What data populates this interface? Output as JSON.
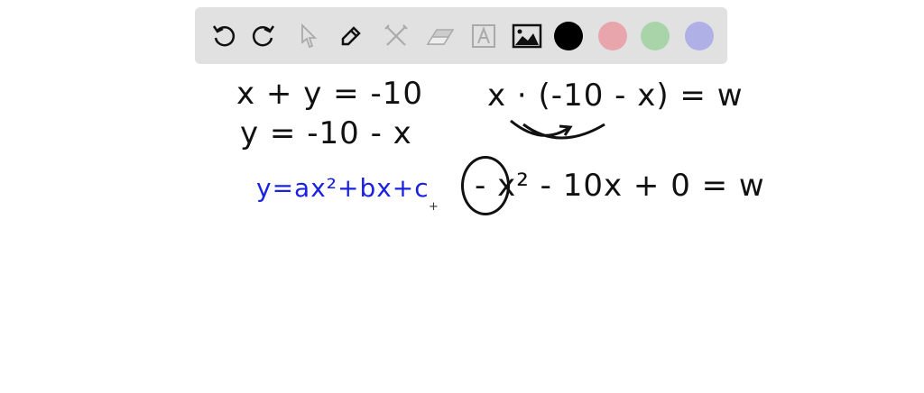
{
  "toolbar": {
    "tools": [
      "undo-icon",
      "redo-icon",
      "select-icon",
      "pen-icon",
      "tools-icon",
      "eraser-icon",
      "text-icon",
      "image-icon"
    ],
    "colors": [
      "#000000",
      "#e8a5ab",
      "#a9d4a9",
      "#aeb0e6"
    ]
  },
  "canvas": {
    "line1": "x + y = -10",
    "line2": "y = -10 - x",
    "line3": "y=ax²+bx+c",
    "line4": "x · (-10 - x) = w",
    "line5": "- x² - 10x + 0 = w"
  }
}
